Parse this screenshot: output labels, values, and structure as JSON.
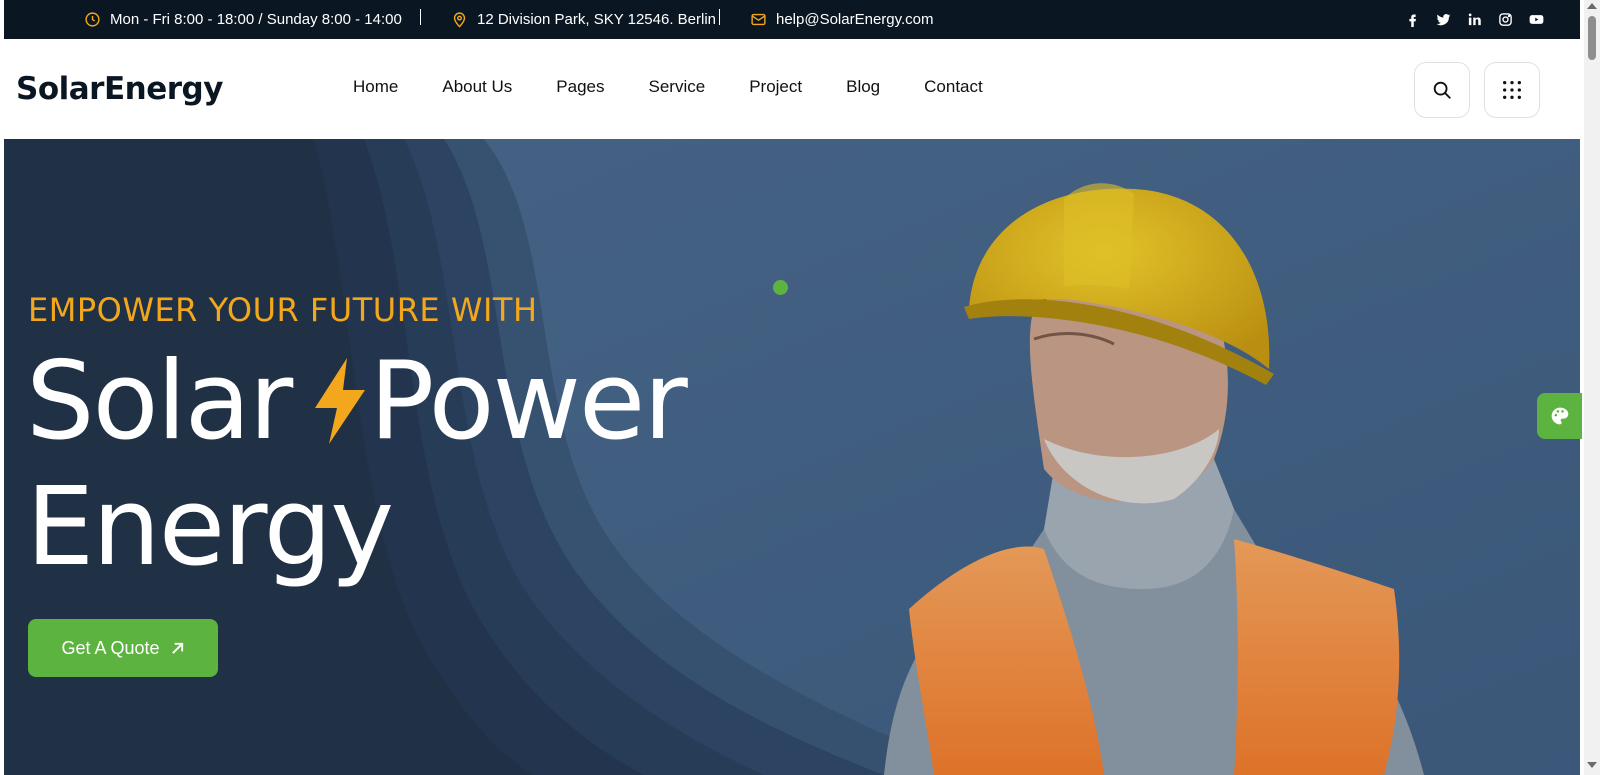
{
  "topbar": {
    "hours": "Mon - Fri 8:00 - 18:00 / Sunday 8:00 - 14:00",
    "address": "12 Division Park, SKY 12546. Berlin",
    "email": "help@SolarEnergy.com",
    "icons": [
      "clock-icon",
      "map-pin-icon",
      "mail-icon"
    ],
    "social": [
      "facebook-icon",
      "twitter-icon",
      "linkedin-icon",
      "instagram-icon",
      "youtube-icon"
    ]
  },
  "header": {
    "logo": "SolarEnergy",
    "nav": [
      "Home",
      "About Us",
      "Pages",
      "Service",
      "Project",
      "Blog",
      "Contact"
    ],
    "buttons": [
      "search-icon",
      "grid-menu-icon"
    ]
  },
  "hero": {
    "tagline": "EMPOWER YOUR FUTURE WITH",
    "headline_word1": "Solar",
    "headline_word2": "Power",
    "headline_word3": "Energy",
    "cta_label": "Get A Quote",
    "cta_icon": "arrow-up-right-icon"
  },
  "colors": {
    "accent_orange": "#f2a71c",
    "accent_green": "#5db33f",
    "dark_navy": "#0b1623"
  }
}
